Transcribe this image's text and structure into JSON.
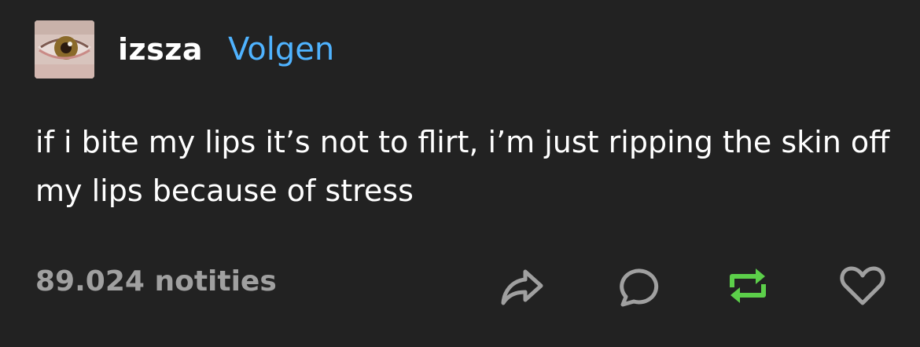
{
  "post": {
    "username": "izsza",
    "follow_label": "Volgen",
    "text": "if i bite my lips it’s not to flirt, i’m just ripping the skin off my lips because of stress",
    "notes_label": "89.024 notities"
  },
  "icons": {
    "share": "share-icon",
    "reply": "reply-icon",
    "reblog": "reblog-icon",
    "like": "heart-icon"
  },
  "colors": {
    "background": "#222222",
    "text": "#ffffff",
    "follow": "#4fb3ff",
    "muted": "#a0a0a0",
    "reblog_active": "#5ccf4a"
  }
}
